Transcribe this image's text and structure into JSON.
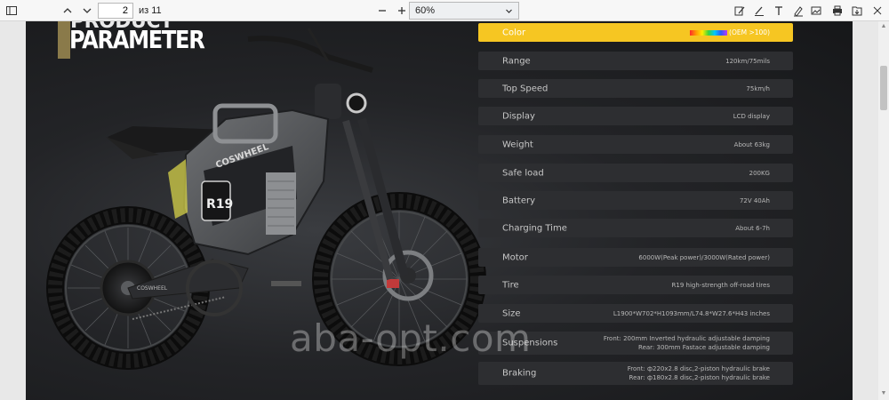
{
  "toolbar": {
    "page_current": "2",
    "page_total": "из 11",
    "zoom_value": "60%"
  },
  "document": {
    "title_top": "PRODUCT",
    "title_main": "PARAMETER",
    "bike_brand": "COSWHEEL",
    "bike_model": "R19",
    "watermark": "aba-opt.com",
    "specs": [
      {
        "label": "Color",
        "value": "(OEM >100)",
        "highlight": true
      },
      {
        "label": "Range",
        "value": "120km/75mils"
      },
      {
        "label": "Top Speed",
        "value": "75km/h"
      },
      {
        "label": "Display",
        "value": "LCD display"
      },
      {
        "label": "Weight",
        "value": "About 63kg"
      },
      {
        "label": "Safe load",
        "value": "200KG"
      },
      {
        "label": "Battery",
        "value": "72V 40Ah"
      },
      {
        "label": "Charging Time",
        "value": "About 6-7h"
      },
      {
        "label": "Motor",
        "value": "6000W(Peak power)/3000W(Rated power)"
      },
      {
        "label": "Tire",
        "value": "R19 high-strength off-road tires"
      },
      {
        "label": "Size",
        "value": "L1900*W702*H1093mm/L74.8*W27.6*H43 inches"
      },
      {
        "label": "Suspensions",
        "value": "Front: 200mm Inverted hydraulic adjustable damping",
        "value2": "Rear: 300mm Fastace adjustable damping"
      },
      {
        "label": "Braking",
        "value": "Front: ф220x2.8 disc,2-piston hydraulic brake",
        "value2": "Rear: ф180x2.8 disc,2-piston hydraulic brake"
      }
    ]
  },
  "colors": {
    "highlight": "#f6c622",
    "row_bg": "#2d2e31",
    "page_bg": "#1e1f22"
  }
}
